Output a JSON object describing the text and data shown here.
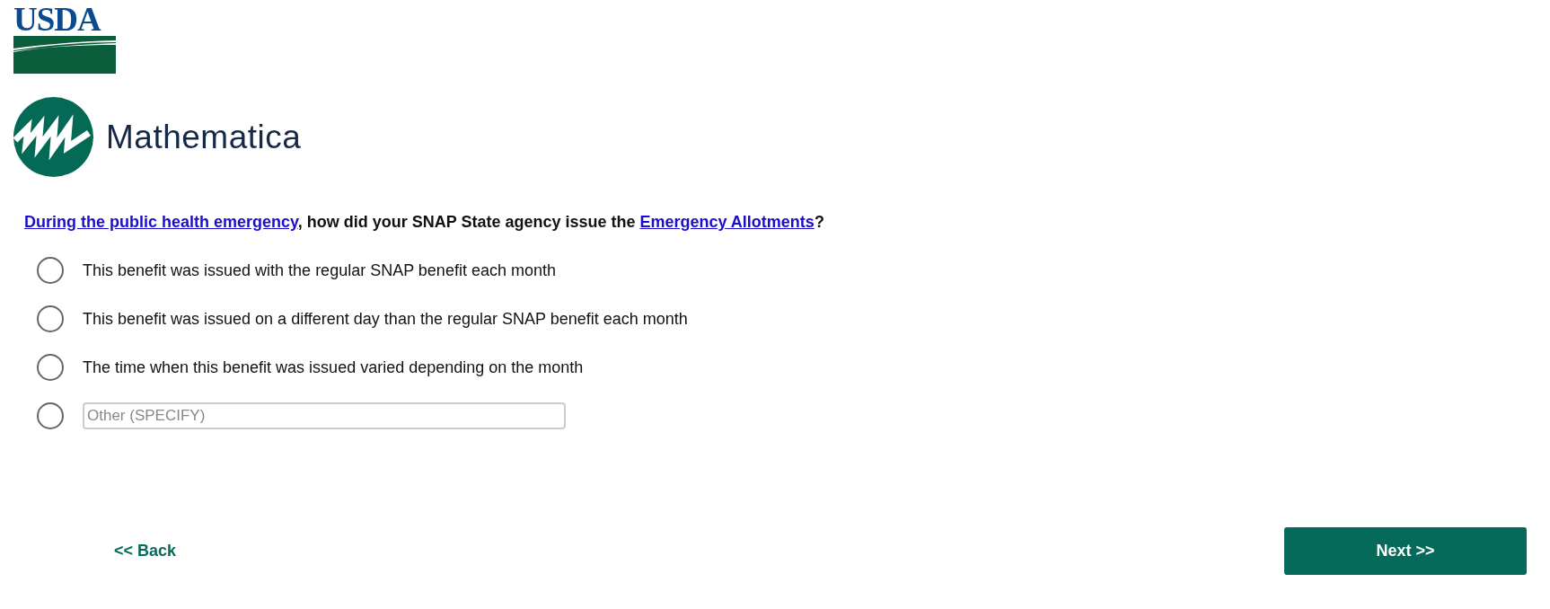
{
  "logos": {
    "usda": "USDA",
    "mathematica": "Mathematica"
  },
  "question": [
    {
      "kind": "link",
      "text": "During the public health emergency"
    },
    {
      "kind": "text",
      "text": ", how did your SNAP State agency issue the "
    },
    {
      "kind": "link",
      "text": "Emergency Allotments"
    },
    {
      "kind": "text",
      "text": "?"
    }
  ],
  "options": [
    {
      "kind": "choice",
      "label": "This benefit was issued with the regular SNAP benefit each month",
      "selected": false
    },
    {
      "kind": "choice",
      "label": "This benefit was issued on a different day than the regular SNAP benefit each month",
      "selected": false
    },
    {
      "kind": "choice",
      "label": "The time when this benefit was issued varied depending on the month",
      "selected": false
    },
    {
      "kind": "other",
      "placeholder": "Other (SPECIFY)",
      "selected": false
    }
  ],
  "back_link": "<< Back",
  "next_button": "Next >>"
}
